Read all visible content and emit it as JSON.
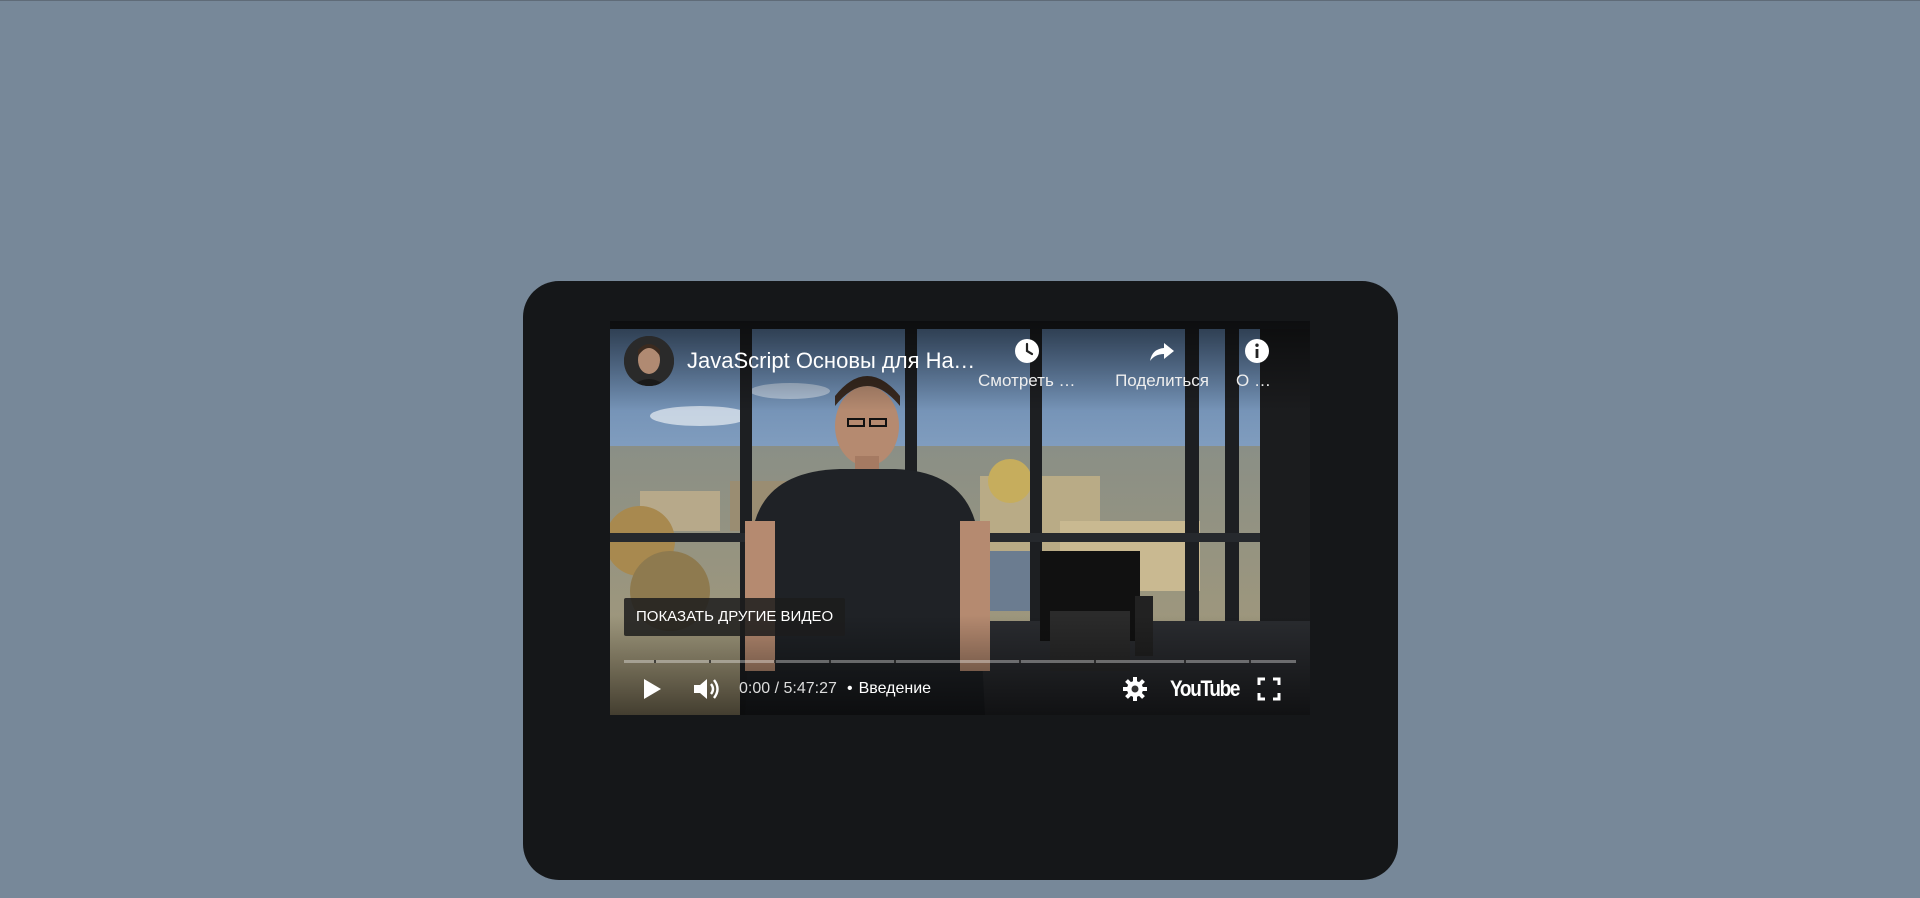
{
  "player": {
    "title": "JavaScript Основы для Начинающих",
    "actions": [
      {
        "icon": "clock-icon",
        "label": "Смотреть позже"
      },
      {
        "icon": "share-icon",
        "label": "Поделиться"
      },
      {
        "icon": "info-icon",
        "label": "О видео"
      }
    ],
    "more_videos_label": "ПОКАЗАТЬ ДРУГИЕ ВИДЕО",
    "progress": 0,
    "time_current": "0:00",
    "time_total": "5:47:27",
    "time_display": "0:00 / 5:47:27",
    "chapter_separator": "•",
    "chapter": "Введение",
    "brand": "YouTube"
  },
  "colors": {
    "page_background": "#778899",
    "card_background": "#151719",
    "progress_played": "#ff0000"
  }
}
